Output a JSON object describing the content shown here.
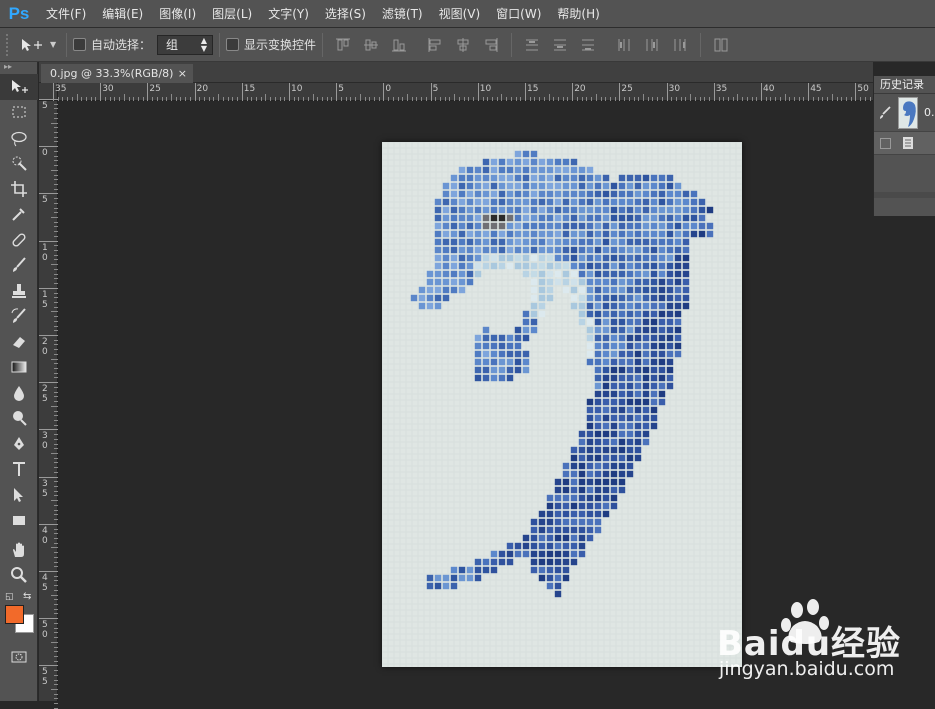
{
  "app": {
    "logo": "Ps"
  },
  "menu": [
    "文件(F)",
    "编辑(E)",
    "图像(I)",
    "图层(L)",
    "文字(Y)",
    "选择(S)",
    "滤镜(T)",
    "视图(V)",
    "窗口(W)",
    "帮助(H)"
  ],
  "options": {
    "auto_select_label": "自动选择：",
    "auto_select_value": "组",
    "show_transform_label": "显示变换控件"
  },
  "document": {
    "tab_title": "0.jpg @ 33.3%(RGB/8)",
    "close_glyph": "×"
  },
  "ruler_h_labels": [
    "35",
    "30",
    "25",
    "20",
    "15",
    "10",
    "5",
    "0",
    "5",
    "10",
    "15",
    "20",
    "25",
    "30",
    "35",
    "40",
    "45",
    "50"
  ],
  "ruler_v_labels": [
    "5",
    "0",
    "5",
    "10",
    "15",
    "20",
    "25",
    "30",
    "35",
    "40",
    "45",
    "50",
    "55"
  ],
  "history_panel": {
    "title": "历史记录",
    "snapshot_label": "0."
  },
  "colors": {
    "foreground": "#f26a2a",
    "background": "#ffffff",
    "accent": "#31a8ff"
  },
  "tools": [
    "move-tool",
    "marquee-tool",
    "lasso-tool",
    "quick-select-tool",
    "crop-tool",
    "eyedropper-tool",
    "healing-brush-tool",
    "brush-tool",
    "clone-stamp-tool",
    "history-brush-tool",
    "eraser-tool",
    "gradient-tool",
    "blur-tool",
    "dodge-tool",
    "pen-tool",
    "type-tool",
    "path-select-tool",
    "rectangle-tool",
    "hand-tool",
    "zoom-tool"
  ],
  "watermark": {
    "brand": "Baidu经验",
    "url": "jingyan.baidu.com"
  }
}
